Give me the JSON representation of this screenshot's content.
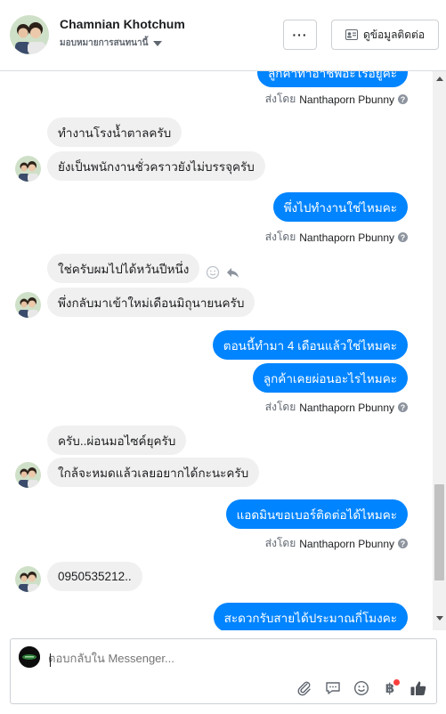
{
  "header": {
    "name": "Chamnian Khotchum",
    "subtitle": "มอบหมายการสนทนานี้",
    "more_label": "···",
    "contact_label": "ดูข้อมูลติดต่อ"
  },
  "messages": {
    "m0": "ลูกค้าทำอาชีพอะไรอยู่คะ",
    "sent_prefix": "ส่งโดย",
    "sender": "Nanthaporn Pbunny",
    "m1": "ทำงานโรงน้ำตาลครับ",
    "m2": "ยังเป็นพนักงานชั่วคราวยังไม่บรรจุครับ",
    "m3": "พึ่งไปทำงานใช่ไหมคะ",
    "m4": "ใช่ครับผมไปได้หวันปีหนึ่ง",
    "m5": "พึ่งกลับมาเข้าใหม่เดือนมิถุนายนครับ",
    "m6": "ตอนนี้ทำมา 4 เดือนแล้วใช่ไหมคะ",
    "m7": "ลูกค้าเคยผ่อนอะไรไหมคะ",
    "m8": "ครับ..ผ่อนมอไซค์ยุครับ",
    "m9": "ใกล้จะหมดแล้วเลยอยากได้กะนะครับ",
    "m10": "แอดมินขอเบอร์ติดต่อได้ไหมคะ",
    "m11": "0950535212..",
    "m12": "สะดวกรับสายได้ประมาณกี่โมงคะ"
  },
  "composer": {
    "placeholder": "ตอบกลับใน Messenger...",
    "baht_symbol": "฿"
  },
  "colors": {
    "outgoing": "#0084ff",
    "incoming": "#f0f0f0",
    "badge": "#fa3e3e"
  }
}
